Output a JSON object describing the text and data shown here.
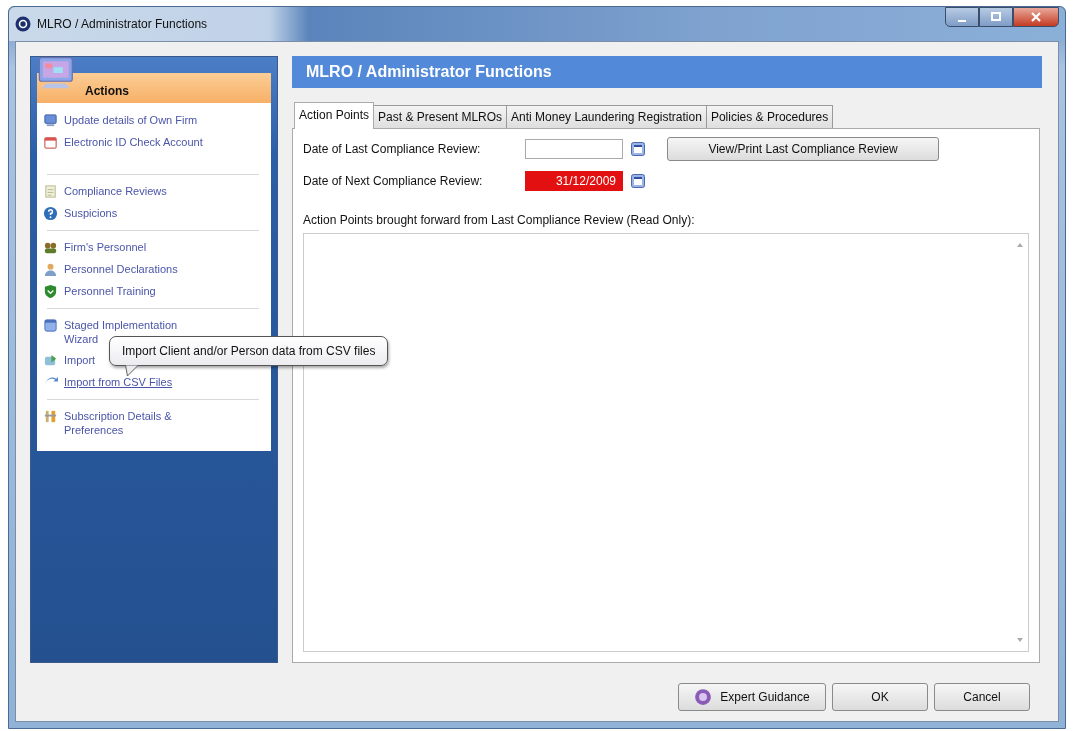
{
  "window": {
    "title": "MLRO / Administrator Functions"
  },
  "sidebar": {
    "title": "Actions",
    "groups": [
      [
        {
          "label": "Update details of Own Firm",
          "hovered": false
        },
        {
          "label": "Electronic ID Check Account",
          "hovered": false
        }
      ],
      [
        {
          "label": "Compliance Reviews",
          "hovered": false
        },
        {
          "label": "Suspicions",
          "hovered": false
        }
      ],
      [
        {
          "label": "Firm's Personnel",
          "hovered": false
        },
        {
          "label": "Personnel Declarations",
          "hovered": false
        },
        {
          "label": "Personnel Training",
          "hovered": false
        }
      ],
      [
        {
          "label": "Staged Implementation Wizard",
          "hovered": false
        },
        {
          "label": "Import",
          "hovered": false
        },
        {
          "label": "Import from CSV Files",
          "hovered": true
        }
      ],
      [
        {
          "label": "Subscription Details & Preferences",
          "hovered": false
        }
      ]
    ]
  },
  "tooltip": "Import Client and/or Person data from CSV files",
  "header": "MLRO / Administrator Functions",
  "tabs": [
    {
      "label": "Action Points",
      "selected": true
    },
    {
      "label": "Past & Present MLROs",
      "selected": false
    },
    {
      "label": "Anti Money Laundering Registration",
      "selected": false
    },
    {
      "label": "Policies & Procedures",
      "selected": false
    }
  ],
  "fields": [
    {
      "label": "Date of Last Compliance Review:",
      "overdue": false,
      "button": "View/Print Last Compliance Review"
    },
    {
      "label": "Date of Next Compliance Review:",
      "value": "31/12/2009",
      "overdue": true
    }
  ],
  "notes": {
    "label": "Action Points brought forward from Last Compliance Review (Read Only):"
  },
  "buttons": [
    {
      "label": "Expert Guidance",
      "kind": "guidance"
    },
    {
      "label": "OK",
      "kind": "plain"
    },
    {
      "label": "Cancel",
      "kind": "plain"
    }
  ]
}
